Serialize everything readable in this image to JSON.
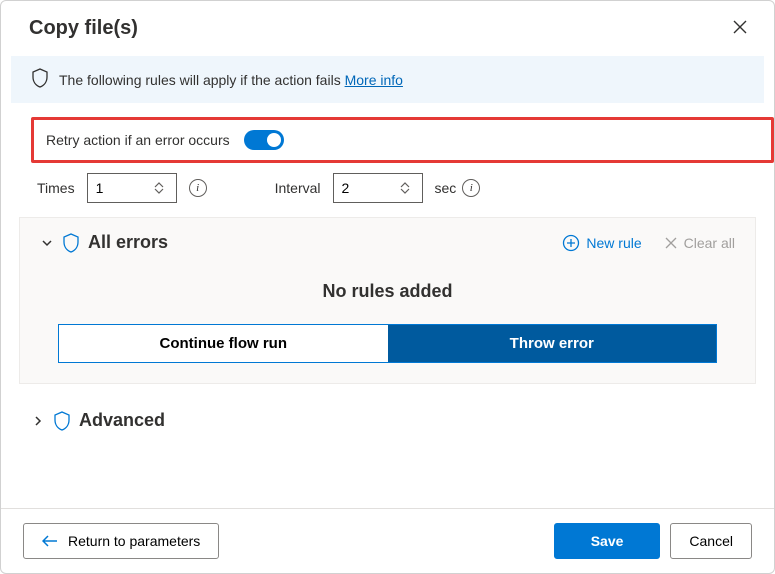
{
  "header": {
    "title": "Copy file(s)"
  },
  "banner": {
    "text": "The following rules will apply if the action fails ",
    "link": "More info"
  },
  "retry": {
    "label": "Retry action if an error occurs",
    "enabled": true
  },
  "params": {
    "times_label": "Times",
    "times_value": "1",
    "interval_label": "Interval",
    "interval_value": "2",
    "interval_unit": "sec"
  },
  "errors": {
    "section_label": "All errors",
    "new_rule": "New rule",
    "clear_all": "Clear all",
    "empty": "No rules added",
    "continue_btn": "Continue flow run",
    "throw_btn": "Throw error",
    "selected": "throw"
  },
  "advanced": {
    "label": "Advanced"
  },
  "footer": {
    "return": "Return to parameters",
    "save": "Save",
    "cancel": "Cancel"
  }
}
